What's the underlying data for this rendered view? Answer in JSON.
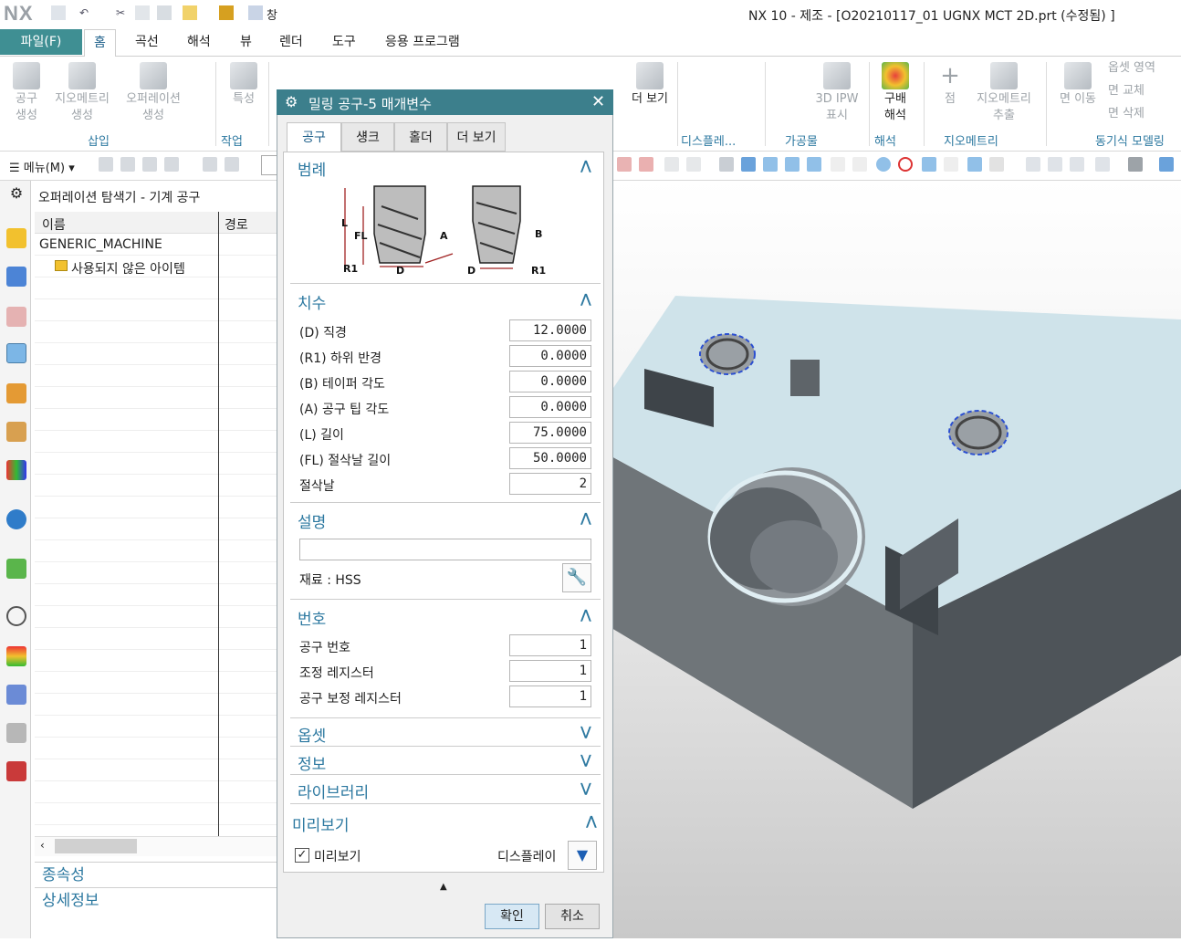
{
  "app": {
    "logo": "NX",
    "window_title": "NX 10 - 제조 - [O20210117_01 UGNX MCT 2D.prt (수정됨) ]",
    "window_menu": "창"
  },
  "menu": {
    "file": "파일(F)",
    "tabs": [
      "홈",
      "곡선",
      "해석",
      "뷰",
      "렌더",
      "도구",
      "응용 프로그램"
    ]
  },
  "ribbon": {
    "buttons": [
      {
        "label": "공구\n생성"
      },
      {
        "label": "지오메트리\n생성"
      },
      {
        "label": "오퍼레이션\n생성"
      },
      {
        "label": "특성"
      },
      {
        "label": "더 보기"
      },
      {
        "label": "3D IPW\n표시"
      },
      {
        "label": "구배\n해석"
      },
      {
        "label": "점"
      },
      {
        "label": "지오메트리\n추출"
      },
      {
        "label": "면 이동"
      },
      {
        "label": "옵셋 영역"
      },
      {
        "label": "면 교체"
      },
      {
        "label": "면 삭제"
      }
    ],
    "groups": [
      "삽입",
      "작업",
      "디스플레...",
      "가공물",
      "해석",
      "지오메트리",
      "동기식 모델링"
    ]
  },
  "toolbar2": {
    "menu": "메뉴(M)"
  },
  "navigator": {
    "title": "오퍼레이션 탐색기 - 기계 공구",
    "columns": [
      "이름",
      "경로"
    ],
    "rows": [
      "GENERIC_MACHINE",
      "사용되지 않은 아이템"
    ],
    "sections": [
      "종속성",
      "상세정보"
    ]
  },
  "dialog": {
    "title": "밀링 공구-5 매개변수",
    "tabs": [
      "공구",
      "섕크",
      "홀더",
      "더 보기"
    ],
    "legend": {
      "header": "범례",
      "labels": {
        "L": "L",
        "FL": "FL",
        "R1": "R1",
        "D": "D",
        "A": "A",
        "B": "B"
      }
    },
    "dimensions": {
      "header": "치수",
      "fields": [
        {
          "label": "(D) 직경",
          "value": "12.0000"
        },
        {
          "label": "(R1) 하위 반경",
          "value": "0.0000"
        },
        {
          "label": "(B) 테이퍼 각도",
          "value": "0.0000"
        },
        {
          "label": "(A) 공구 팁 각도",
          "value": "0.0000"
        },
        {
          "label": "(L) 길이",
          "value": "75.0000"
        },
        {
          "label": "(FL) 절삭날 길이",
          "value": "50.0000"
        },
        {
          "label": "절삭날",
          "value": "2"
        }
      ]
    },
    "description": {
      "header": "설명",
      "value": "",
      "material": "재료 : HSS"
    },
    "numbers": {
      "header": "번호",
      "fields": [
        {
          "label": "공구 번호",
          "value": "1"
        },
        {
          "label": "조정 레지스터",
          "value": "1"
        },
        {
          "label": "공구 보정 레지스터",
          "value": "1"
        }
      ]
    },
    "collapsed": [
      "옵셋",
      "정보",
      "라이브러리"
    ],
    "preview": {
      "header": "미리보기",
      "checkbox": "미리보기",
      "checked": true,
      "display": "디스플레이"
    },
    "ok": "확인",
    "cancel": "취소"
  }
}
